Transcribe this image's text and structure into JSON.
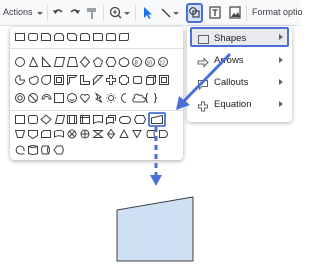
{
  "toolbar": {
    "actions_label": "Actions",
    "format_options_label": "Format optio",
    "buttons": [
      "undo",
      "redo",
      "paint-format",
      "zoom",
      "select",
      "line",
      "shape",
      "text-box",
      "image"
    ]
  },
  "shape_menu": {
    "items": [
      {
        "label": "Shapes",
        "icon": "shapes-icon",
        "has_submenu": true,
        "highlighted": true
      },
      {
        "label": "Arrows",
        "icon": "arrows-icon",
        "has_submenu": true
      },
      {
        "label": "Callouts",
        "icon": "callouts-icon",
        "has_submenu": true
      },
      {
        "label": "Equation",
        "icon": "equation-icon",
        "has_submenu": true
      }
    ]
  },
  "shape_grid": {
    "sections": [
      "basic-shapes",
      "more-shapes",
      "flowchart"
    ],
    "selected_shape": "flowchart-manual-input"
  },
  "colors": {
    "accent": "#4a6fd6",
    "shape_fill": "#cfe0f3",
    "toolbar_bg": "#f8f9fb",
    "highlight_bg": "#e8eaed"
  },
  "canvas": {
    "inserted_shape": "flowchart-manual-input"
  }
}
